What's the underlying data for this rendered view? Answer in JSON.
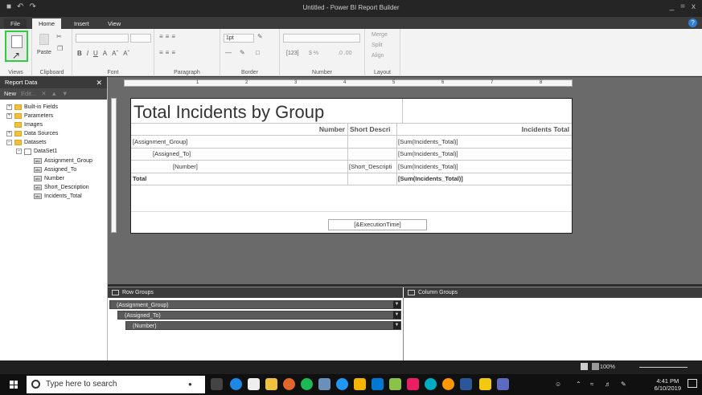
{
  "window": {
    "title": "Untitled - Power BI Report Builder",
    "controls": [
      "_",
      "=",
      "x"
    ]
  },
  "tabs": [
    {
      "label": "File"
    },
    {
      "label": "Home"
    },
    {
      "label": "Insert"
    },
    {
      "label": "View"
    }
  ],
  "help_label": "?",
  "ribbon": {
    "views": "Views",
    "clipboard": "Clipboard",
    "paste": "Paste",
    "font": "Font",
    "paragraph": "Paragraph",
    "border": "Border",
    "border_width": "1pt",
    "number": "Number",
    "layout": "Layout",
    "merge": "Merge",
    "split": "Split",
    "align": "Align",
    "number_format": "$ %",
    "font_buttons": [
      "B",
      "I",
      "U",
      "A",
      "Aˆ",
      "Aˇ"
    ]
  },
  "report_data": {
    "header": "Report Data",
    "toolbar": {
      "new": "New",
      "edit": "Edit..."
    },
    "tree": [
      {
        "label": "Built-in Fields",
        "kind": "folder"
      },
      {
        "label": "Parameters",
        "kind": "folder"
      },
      {
        "label": "Images",
        "kind": "folder"
      },
      {
        "label": "Data Sources",
        "kind": "folder"
      },
      {
        "label": "Datasets",
        "kind": "folder"
      },
      {
        "label": "DataSet1",
        "kind": "dataset"
      },
      {
        "label": "Assignment_Group",
        "kind": "field"
      },
      {
        "label": "Assigned_To",
        "kind": "field"
      },
      {
        "label": "Number",
        "kind": "field"
      },
      {
        "label": "Short_Description",
        "kind": "field"
      },
      {
        "label": "Incidents_Total",
        "kind": "field"
      }
    ],
    "field_icon_text": "abc"
  },
  "ruler": {
    "numbers": [
      "1",
      "2",
      "3",
      "4",
      "5",
      "6",
      "7",
      "8"
    ]
  },
  "report": {
    "title": "Total Incidents by Group",
    "headers": {
      "number": "Number",
      "short_desc": "Short Descri",
      "incidents_total": "Incidents Total"
    },
    "rows": [
      {
        "group": "[Assignment_Group]",
        "number": "",
        "short": "",
        "total": "[Sum(Incidents_Total)]"
      },
      {
        "group": "[Assigned_To]",
        "number": "",
        "short": "",
        "total": "[Sum(Incidents_Total)]"
      },
      {
        "group": "[Number]",
        "number": "",
        "short": "[Short_Descripti",
        "total": "[Sum(Incidents_Total)]"
      },
      {
        "group": "Total",
        "number": "",
        "short": "",
        "total": "[Sum(Incidents_Total)]"
      }
    ],
    "exec_time": "[&ExecutionTime]"
  },
  "grouping": {
    "row_groups_label": "Row Groups",
    "column_groups_label": "Column Groups",
    "row_groups": [
      "(Assignment_Group)",
      "(Assigned_To)",
      "(Number)"
    ]
  },
  "status": {
    "zoom": "100%"
  },
  "taskbar": {
    "search_placeholder": "Type here to search",
    "time": "4:41 PM",
    "date": "6/10/2019"
  },
  "colors": {
    "views_highlight": "#2ecc40",
    "title_bar": "#252526"
  }
}
